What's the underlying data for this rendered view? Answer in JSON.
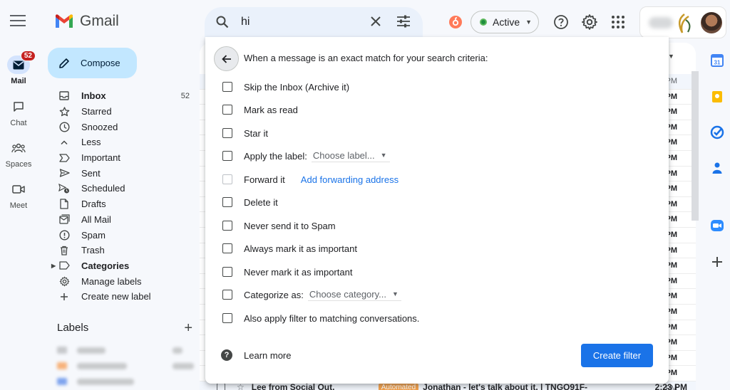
{
  "app": {
    "name": "Gmail"
  },
  "rail": {
    "items": [
      {
        "label": "Mail",
        "badge": "52"
      },
      {
        "label": "Chat"
      },
      {
        "label": "Spaces"
      },
      {
        "label": "Meet"
      }
    ]
  },
  "compose": {
    "label": "Compose"
  },
  "nav": {
    "items": [
      {
        "label": "Inbox",
        "count": "52",
        "icon": "inbox-icon"
      },
      {
        "label": "Starred",
        "icon": "star-icon"
      },
      {
        "label": "Snoozed",
        "icon": "clock-icon"
      },
      {
        "label": "Less",
        "icon": "chevron-up-icon"
      },
      {
        "label": "Important",
        "icon": "important-icon"
      },
      {
        "label": "Sent",
        "icon": "send-icon"
      },
      {
        "label": "Scheduled",
        "icon": "scheduled-icon"
      },
      {
        "label": "Drafts",
        "icon": "draft-icon"
      },
      {
        "label": "All Mail",
        "icon": "all-mail-icon"
      },
      {
        "label": "Spam",
        "icon": "spam-icon"
      },
      {
        "label": "Trash",
        "icon": "trash-icon"
      },
      {
        "label": "Categories",
        "icon": "label-icon"
      },
      {
        "label": "Manage labels",
        "icon": "gear-icon"
      },
      {
        "label": "Create new label",
        "icon": "plus-icon"
      }
    ]
  },
  "labels": {
    "heading": "Labels"
  },
  "search": {
    "value": "hi"
  },
  "status": {
    "label": "Active"
  },
  "filter": {
    "criteria_text": "When a message is an exact match for your search criteria:",
    "options": {
      "skip_inbox": "Skip the Inbox (Archive it)",
      "mark_read": "Mark as read",
      "star": "Star it",
      "apply_label": "Apply the label:",
      "apply_label_select": "Choose label...",
      "forward": "Forward it",
      "forward_link": "Add forwarding address",
      "delete": "Delete it",
      "never_spam": "Never send it to Spam",
      "always_important": "Always mark it as important",
      "never_important": "Never mark it as important",
      "categorize": "Categorize as:",
      "categorize_select": "Choose category...",
      "also_apply": "Also apply filter to matching conversations."
    },
    "learn_more": "Learn more",
    "create_button": "Create filter"
  },
  "list": {
    "times": [
      "PM",
      "PM",
      "PM",
      "PM",
      "PM",
      "PM",
      "PM",
      "PM",
      "PM",
      "PM",
      "PM",
      "PM",
      "PM",
      "PM",
      "PM",
      "PM",
      "PM",
      "PM",
      "PM",
      "PM",
      "PM"
    ],
    "bottom_row": {
      "sender": "Lee from Social Out.",
      "tag": "Automated",
      "subject": "Jonathan - let's talk about it. | TNGQ91F-",
      "time": "2:23 PM"
    }
  },
  "colors": {
    "accent": "#1a73e8",
    "compose_bg": "#c2e7ff",
    "badge": "#c5221f",
    "active_dot": "#1e8e3e"
  }
}
